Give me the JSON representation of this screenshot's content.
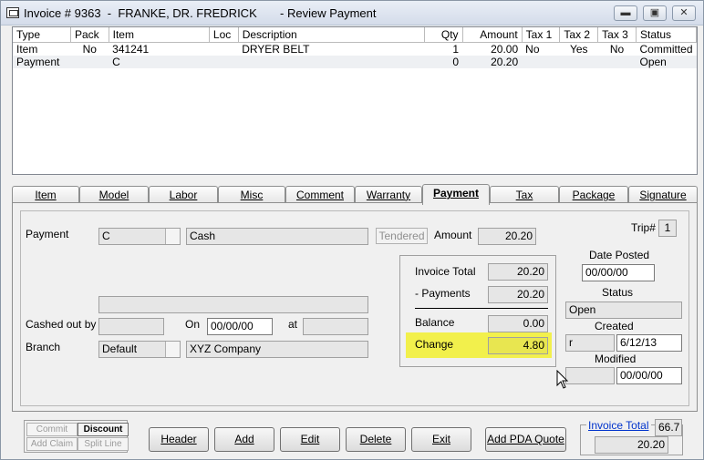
{
  "window": {
    "title": "Invoice # 9363  -  FRANKE, DR. FREDRICK       - Review Payment",
    "minimize": "▬",
    "maximize": "▣",
    "close": "✕"
  },
  "grid": {
    "columns": [
      "Type",
      "Pack",
      "Item",
      "Loc",
      "Description",
      "Qty",
      "Amount",
      "Tax 1",
      "Tax 2",
      "Tax 3",
      "Status"
    ],
    "rows": [
      [
        "Item",
        "No",
        "341241",
        "",
        "DRYER BELT",
        "1",
        "20.00",
        "No",
        "Yes",
        "No",
        "Committed"
      ],
      [
        "Payment",
        "",
        "C",
        "",
        "",
        "0",
        "20.20",
        "",
        "",
        "",
        "Open"
      ]
    ]
  },
  "tabs": [
    "Item",
    "Model",
    "Labor",
    "Misc",
    "Comment",
    "Warranty",
    "Payment",
    "Tax",
    "Package",
    "Signature"
  ],
  "active_tab": "Payment",
  "payment": {
    "payment_label": "Payment",
    "payment_code": "C",
    "payment_desc": "Cash",
    "tendered_label": "Tendered",
    "amount_label": "Amount",
    "amount_value": "20.20",
    "trip_label": "Trip#",
    "trip_value": "1",
    "cashed_out_label": "Cashed out by",
    "cashed_out_value": "",
    "on_label": "On",
    "on_value": "00/00/00",
    "at_label": "at",
    "at_value": "",
    "branch_label": "Branch",
    "branch_value": "Default",
    "branch_company": "XYZ Company",
    "notes_value": ""
  },
  "totals": {
    "invoice_total_label": "Invoice Total",
    "invoice_total_value": "20.20",
    "payments_label": "- Payments",
    "payments_value": "20.20",
    "balance_label": "Balance",
    "balance_value": "0.00",
    "change_label": "Change",
    "change_value": "4.80"
  },
  "status_panel": {
    "date_posted_label": "Date Posted",
    "date_posted_value": "00/00/00",
    "status_label": "Status",
    "status_value": "Open",
    "created_label": "Created",
    "created_by": "r",
    "created_value": "6/12/13",
    "modified_label": "Modified",
    "modified_by": "",
    "modified_value": "00/00/00"
  },
  "left_buttons": {
    "commit": "Commit",
    "discount": "Discount",
    "add_claim": "Add Claim",
    "split_line": "Split Line"
  },
  "buttons": {
    "header": "Header",
    "add": "Add",
    "edit": "Edit",
    "delete": "Delete",
    "exit": "Exit",
    "add_pda_quote": "Add PDA Quote"
  },
  "footer": {
    "invoice_total_link": "Invoice Total",
    "side_value": "66.7",
    "invoice_total_value": "20.20"
  },
  "colors": {
    "highlight": "#f2f04c",
    "link": "#0033cc"
  }
}
